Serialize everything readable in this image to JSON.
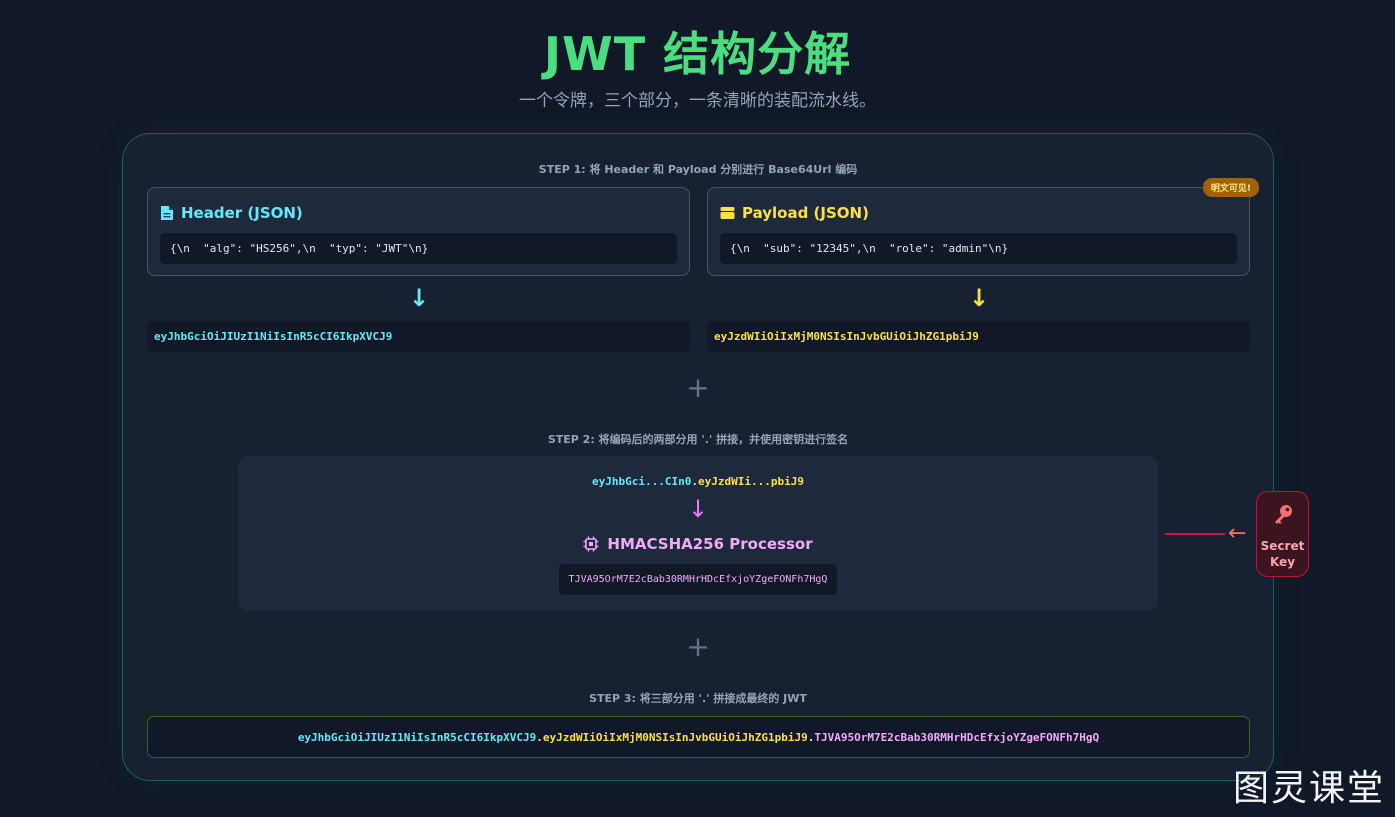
{
  "header": {
    "title": "JWT 结构分解",
    "subtitle": "一个令牌，三个部分，一条清晰的装配流水线。"
  },
  "step1": {
    "title": "STEP 1: 将 Header 和 Payload 分别进行 Base64Url 编码",
    "header_card": {
      "title": "Header (JSON)",
      "icon": "file-icon",
      "code": "{\\n  \"alg\": \"HS256\",\\n  \"typ\": \"JWT\"\\n}",
      "encoded": "eyJhbGciOiJIUzI1NiIsInR5cCI6IkpXVCJ9"
    },
    "payload_card": {
      "title": "Payload (JSON)",
      "icon": "wallet-icon",
      "badge": "明文可见!",
      "code": "{\\n  \"sub\": \"12345\",\\n  \"role\": \"admin\"\\n}",
      "encoded": "eyJzdWIiOiIxMjM0NSIsInJvbGUiOiJhZG1pbiJ9"
    },
    "arrow": "↓"
  },
  "plus": "+",
  "step2": {
    "title": "STEP 2: 将编码后的两部分用 '.' 拼接，并使用密钥进行签名",
    "concat_header": "eyJhbGci...CIn0",
    "concat_dot": ".",
    "concat_payload": "eyJzdWIi...pbiJ9",
    "arrow": "↓",
    "processor": "HMACSHA256 Processor",
    "signature": "TJVA95OrM7E2cBab30RMHrHDcEfxjoYZgeFONFh7HgQ",
    "secret_key_label": "Secret Key",
    "key_arrow": "←"
  },
  "step3": {
    "title": "STEP 3: 将三部分用 '.' 拼接成最终的 JWT",
    "part1": "eyJhbGciOiJIUzI1NiIsInR5cCI6IkpXVCJ9",
    "dot1": ".",
    "part2": "eyJzdWIiOiIxMjM0NSIsInJvbGUiOiJhZG1pbiJ9",
    "dot2": ".",
    "part3": "TJVA95OrM7E2cBab30RMHrHDcEfxjoYZgeFONFh7HgQ"
  },
  "watermark": "图灵课堂",
  "colors": {
    "title": "#4ade80",
    "header": "#67e8f9",
    "payload": "#fde047",
    "signature": "#f0abfc",
    "key": "#f87171"
  }
}
